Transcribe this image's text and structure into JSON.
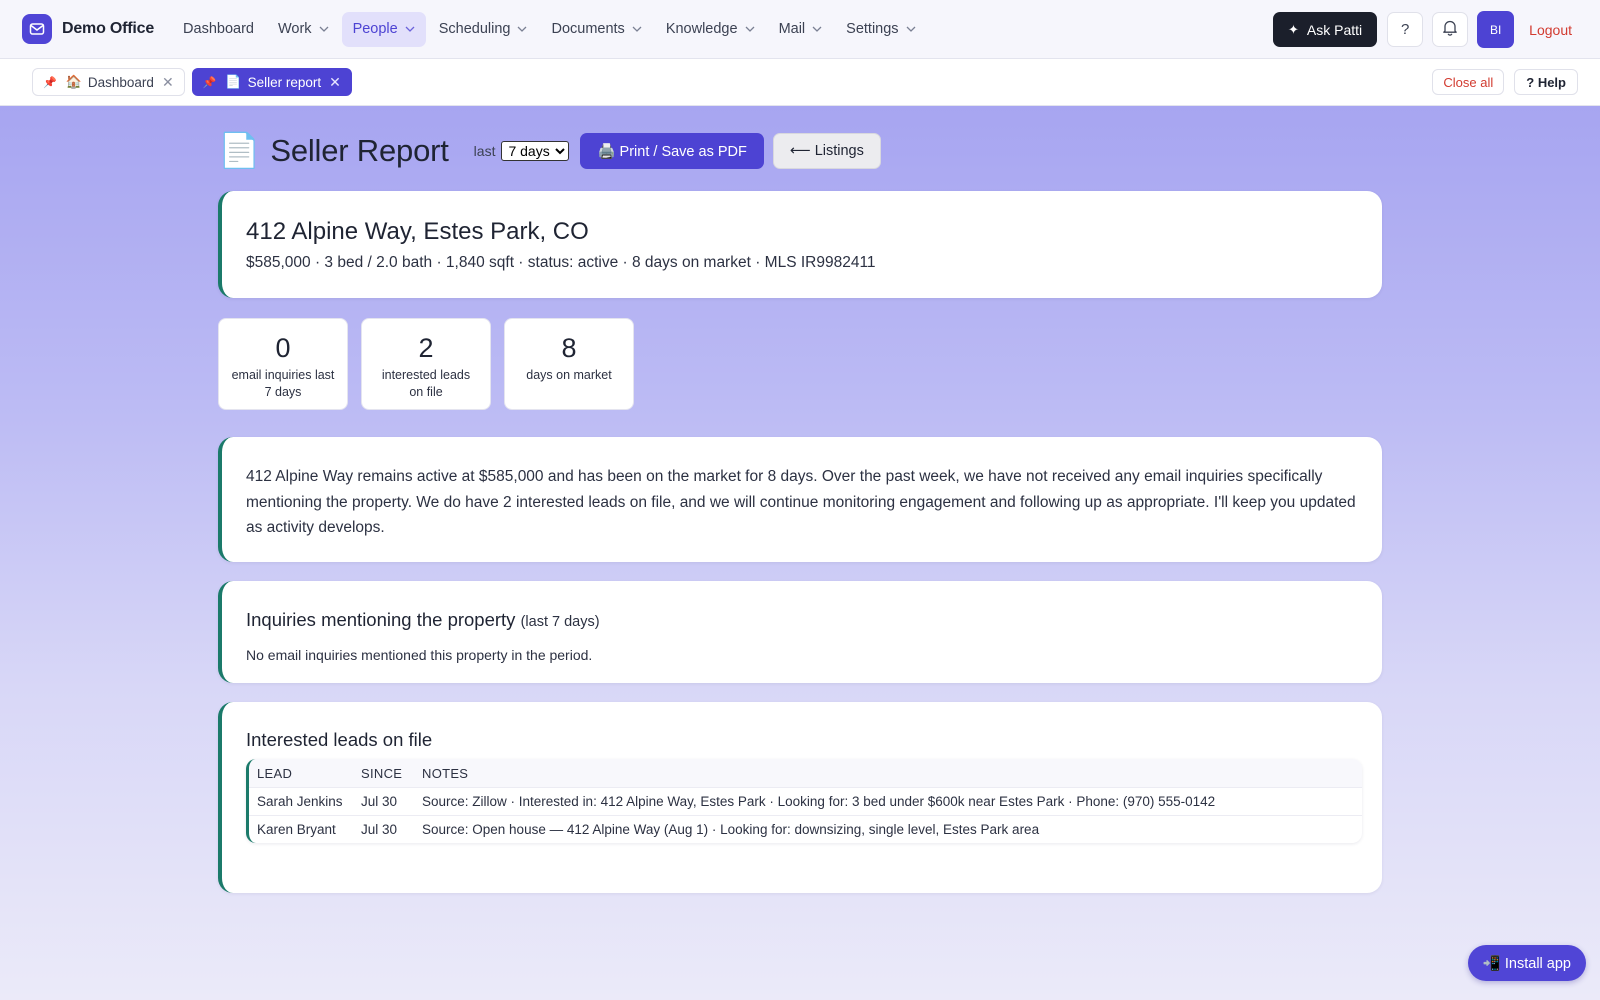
{
  "app": {
    "name": "Demo Office"
  },
  "nav": {
    "items": [
      {
        "label": "Dashboard",
        "dropdown": false,
        "active": false
      },
      {
        "label": "Work",
        "dropdown": true,
        "active": false
      },
      {
        "label": "People",
        "dropdown": true,
        "active": true
      },
      {
        "label": "Scheduling",
        "dropdown": true,
        "active": false
      },
      {
        "label": "Documents",
        "dropdown": true,
        "active": false
      },
      {
        "label": "Knowledge",
        "dropdown": true,
        "active": false
      },
      {
        "label": "Mail",
        "dropdown": true,
        "active": false
      },
      {
        "label": "Settings",
        "dropdown": true,
        "active": false
      }
    ],
    "ask_label": "Ask Patti",
    "help_glyph": "?",
    "avatar_initials": "BI",
    "logout_label": "Logout"
  },
  "tabs": {
    "items": [
      {
        "icon": "🏠",
        "label": "Dashboard",
        "active": false
      },
      {
        "icon": "📄",
        "label": "Seller report",
        "active": true
      }
    ],
    "close_all_label": "Close all",
    "help_label": "? Help"
  },
  "page": {
    "icon": "📄",
    "title": "Seller Report",
    "range_label": "last",
    "range_selected": "7 days",
    "print_label": "🖨️ Print / Save as PDF",
    "back_label": "⟵ Listings"
  },
  "property": {
    "address": "412 Alpine Way, Estes Park, CO",
    "meta": "$585,000 · 3 bed / 2.0 bath · 1,840 sqft · status: active · 8 days on market · MLS IR9982411"
  },
  "stats": [
    {
      "value": "0",
      "label": "email inquiries last 7 days"
    },
    {
      "value": "2",
      "label": "interested leads on file"
    },
    {
      "value": "8",
      "label": "days on market"
    }
  ],
  "summary": "412 Alpine Way remains active at $585,000 and has been on the market for 8 days. Over the past week, we have not received any email inquiries specifically mentioning the property. We do have 2 interested leads on file, and we will continue monitoring engagement and following up as appropriate. I'll keep you updated as activity develops.",
  "inquiries": {
    "title": "Inquiries mentioning the property",
    "subtitle": "(last 7 days)",
    "empty_text": "No email inquiries mentioned this property in the period."
  },
  "leads": {
    "title": "Interested leads on file",
    "columns": [
      "LEAD",
      "SINCE",
      "NOTES"
    ],
    "rows": [
      {
        "lead": "Sarah Jenkins",
        "since": "Jul 30",
        "notes": "Source: Zillow · Interested in: 412 Alpine Way, Estes Park · Looking for: 3 bed under $600k near Estes Park · Phone: (970) 555-0142"
      },
      {
        "lead": "Karen Bryant",
        "since": "Jul 30",
        "notes": "Source: Open house — 412 Alpine Way (Aug 1) · Looking for: downsizing, single level, Estes Park area"
      }
    ]
  },
  "install_label": "📲 Install app",
  "colors": {
    "accent": "#4d43d3",
    "card_border": "#1b7a6a",
    "logout": "#d23b30",
    "ask_bg": "#1b1f2b"
  }
}
